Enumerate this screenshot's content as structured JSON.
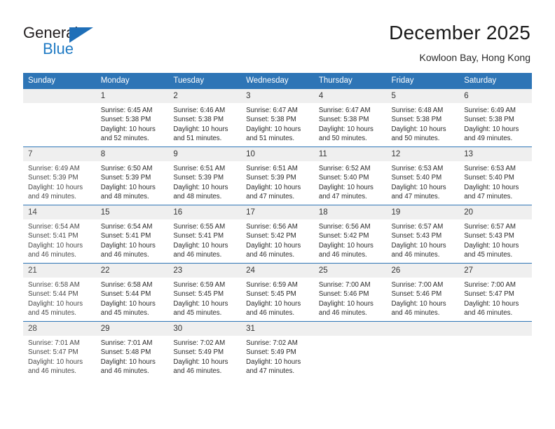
{
  "brand": {
    "word_one": "General",
    "word_two": "Blue",
    "triangle_icon": "triangle-icon",
    "accent_color": "#1f7ac4"
  },
  "header": {
    "month_title": "December 2025",
    "location": "Kowloon Bay, Hong Kong"
  },
  "calendar": {
    "header_color": "#2e75b6",
    "daynum_band_color": "#efefef",
    "weekday_headers": [
      "Sunday",
      "Monday",
      "Tuesday",
      "Wednesday",
      "Thursday",
      "Friday",
      "Saturday"
    ],
    "weeks": [
      [
        {
          "day": "",
          "sunrise": "",
          "sunset": "",
          "daylight_line1": "",
          "daylight_line2": "",
          "blank": true
        },
        {
          "day": "1",
          "sunrise": "Sunrise: 6:45 AM",
          "sunset": "Sunset: 5:38 PM",
          "daylight_line1": "Daylight: 10 hours",
          "daylight_line2": "and 52 minutes."
        },
        {
          "day": "2",
          "sunrise": "Sunrise: 6:46 AM",
          "sunset": "Sunset: 5:38 PM",
          "daylight_line1": "Daylight: 10 hours",
          "daylight_line2": "and 51 minutes."
        },
        {
          "day": "3",
          "sunrise": "Sunrise: 6:47 AM",
          "sunset": "Sunset: 5:38 PM",
          "daylight_line1": "Daylight: 10 hours",
          "daylight_line2": "and 51 minutes."
        },
        {
          "day": "4",
          "sunrise": "Sunrise: 6:47 AM",
          "sunset": "Sunset: 5:38 PM",
          "daylight_line1": "Daylight: 10 hours",
          "daylight_line2": "and 50 minutes."
        },
        {
          "day": "5",
          "sunrise": "Sunrise: 6:48 AM",
          "sunset": "Sunset: 5:38 PM",
          "daylight_line1": "Daylight: 10 hours",
          "daylight_line2": "and 50 minutes."
        },
        {
          "day": "6",
          "sunrise": "Sunrise: 6:49 AM",
          "sunset": "Sunset: 5:38 PM",
          "daylight_line1": "Daylight: 10 hours",
          "daylight_line2": "and 49 minutes."
        }
      ],
      [
        {
          "day": "7",
          "sunrise": "Sunrise: 6:49 AM",
          "sunset": "Sunset: 5:39 PM",
          "daylight_line1": "Daylight: 10 hours",
          "daylight_line2": "and 49 minutes."
        },
        {
          "day": "8",
          "sunrise": "Sunrise: 6:50 AM",
          "sunset": "Sunset: 5:39 PM",
          "daylight_line1": "Daylight: 10 hours",
          "daylight_line2": "and 48 minutes."
        },
        {
          "day": "9",
          "sunrise": "Sunrise: 6:51 AM",
          "sunset": "Sunset: 5:39 PM",
          "daylight_line1": "Daylight: 10 hours",
          "daylight_line2": "and 48 minutes."
        },
        {
          "day": "10",
          "sunrise": "Sunrise: 6:51 AM",
          "sunset": "Sunset: 5:39 PM",
          "daylight_line1": "Daylight: 10 hours",
          "daylight_line2": "and 47 minutes."
        },
        {
          "day": "11",
          "sunrise": "Sunrise: 6:52 AM",
          "sunset": "Sunset: 5:40 PM",
          "daylight_line1": "Daylight: 10 hours",
          "daylight_line2": "and 47 minutes."
        },
        {
          "day": "12",
          "sunrise": "Sunrise: 6:53 AM",
          "sunset": "Sunset: 5:40 PM",
          "daylight_line1": "Daylight: 10 hours",
          "daylight_line2": "and 47 minutes."
        },
        {
          "day": "13",
          "sunrise": "Sunrise: 6:53 AM",
          "sunset": "Sunset: 5:40 PM",
          "daylight_line1": "Daylight: 10 hours",
          "daylight_line2": "and 47 minutes."
        }
      ],
      [
        {
          "day": "14",
          "sunrise": "Sunrise: 6:54 AM",
          "sunset": "Sunset: 5:41 PM",
          "daylight_line1": "Daylight: 10 hours",
          "daylight_line2": "and 46 minutes."
        },
        {
          "day": "15",
          "sunrise": "Sunrise: 6:54 AM",
          "sunset": "Sunset: 5:41 PM",
          "daylight_line1": "Daylight: 10 hours",
          "daylight_line2": "and 46 minutes."
        },
        {
          "day": "16",
          "sunrise": "Sunrise: 6:55 AM",
          "sunset": "Sunset: 5:41 PM",
          "daylight_line1": "Daylight: 10 hours",
          "daylight_line2": "and 46 minutes."
        },
        {
          "day": "17",
          "sunrise": "Sunrise: 6:56 AM",
          "sunset": "Sunset: 5:42 PM",
          "daylight_line1": "Daylight: 10 hours",
          "daylight_line2": "and 46 minutes."
        },
        {
          "day": "18",
          "sunrise": "Sunrise: 6:56 AM",
          "sunset": "Sunset: 5:42 PM",
          "daylight_line1": "Daylight: 10 hours",
          "daylight_line2": "and 46 minutes."
        },
        {
          "day": "19",
          "sunrise": "Sunrise: 6:57 AM",
          "sunset": "Sunset: 5:43 PM",
          "daylight_line1": "Daylight: 10 hours",
          "daylight_line2": "and 46 minutes."
        },
        {
          "day": "20",
          "sunrise": "Sunrise: 6:57 AM",
          "sunset": "Sunset: 5:43 PM",
          "daylight_line1": "Daylight: 10 hours",
          "daylight_line2": "and 45 minutes."
        }
      ],
      [
        {
          "day": "21",
          "sunrise": "Sunrise: 6:58 AM",
          "sunset": "Sunset: 5:44 PM",
          "daylight_line1": "Daylight: 10 hours",
          "daylight_line2": "and 45 minutes."
        },
        {
          "day": "22",
          "sunrise": "Sunrise: 6:58 AM",
          "sunset": "Sunset: 5:44 PM",
          "daylight_line1": "Daylight: 10 hours",
          "daylight_line2": "and 45 minutes."
        },
        {
          "day": "23",
          "sunrise": "Sunrise: 6:59 AM",
          "sunset": "Sunset: 5:45 PM",
          "daylight_line1": "Daylight: 10 hours",
          "daylight_line2": "and 45 minutes."
        },
        {
          "day": "24",
          "sunrise": "Sunrise: 6:59 AM",
          "sunset": "Sunset: 5:45 PM",
          "daylight_line1": "Daylight: 10 hours",
          "daylight_line2": "and 46 minutes."
        },
        {
          "day": "25",
          "sunrise": "Sunrise: 7:00 AM",
          "sunset": "Sunset: 5:46 PM",
          "daylight_line1": "Daylight: 10 hours",
          "daylight_line2": "and 46 minutes."
        },
        {
          "day": "26",
          "sunrise": "Sunrise: 7:00 AM",
          "sunset": "Sunset: 5:46 PM",
          "daylight_line1": "Daylight: 10 hours",
          "daylight_line2": "and 46 minutes."
        },
        {
          "day": "27",
          "sunrise": "Sunrise: 7:00 AM",
          "sunset": "Sunset: 5:47 PM",
          "daylight_line1": "Daylight: 10 hours",
          "daylight_line2": "and 46 minutes."
        }
      ],
      [
        {
          "day": "28",
          "sunrise": "Sunrise: 7:01 AM",
          "sunset": "Sunset: 5:47 PM",
          "daylight_line1": "Daylight: 10 hours",
          "daylight_line2": "and 46 minutes."
        },
        {
          "day": "29",
          "sunrise": "Sunrise: 7:01 AM",
          "sunset": "Sunset: 5:48 PM",
          "daylight_line1": "Daylight: 10 hours",
          "daylight_line2": "and 46 minutes."
        },
        {
          "day": "30",
          "sunrise": "Sunrise: 7:02 AM",
          "sunset": "Sunset: 5:49 PM",
          "daylight_line1": "Daylight: 10 hours",
          "daylight_line2": "and 46 minutes."
        },
        {
          "day": "31",
          "sunrise": "Sunrise: 7:02 AM",
          "sunset": "Sunset: 5:49 PM",
          "daylight_line1": "Daylight: 10 hours",
          "daylight_line2": "and 47 minutes."
        },
        {
          "day": "",
          "sunrise": "",
          "sunset": "",
          "daylight_line1": "",
          "daylight_line2": "",
          "blank": true
        },
        {
          "day": "",
          "sunrise": "",
          "sunset": "",
          "daylight_line1": "",
          "daylight_line2": "",
          "blank": true
        },
        {
          "day": "",
          "sunrise": "",
          "sunset": "",
          "daylight_line1": "",
          "daylight_line2": "",
          "blank": true
        }
      ]
    ]
  }
}
